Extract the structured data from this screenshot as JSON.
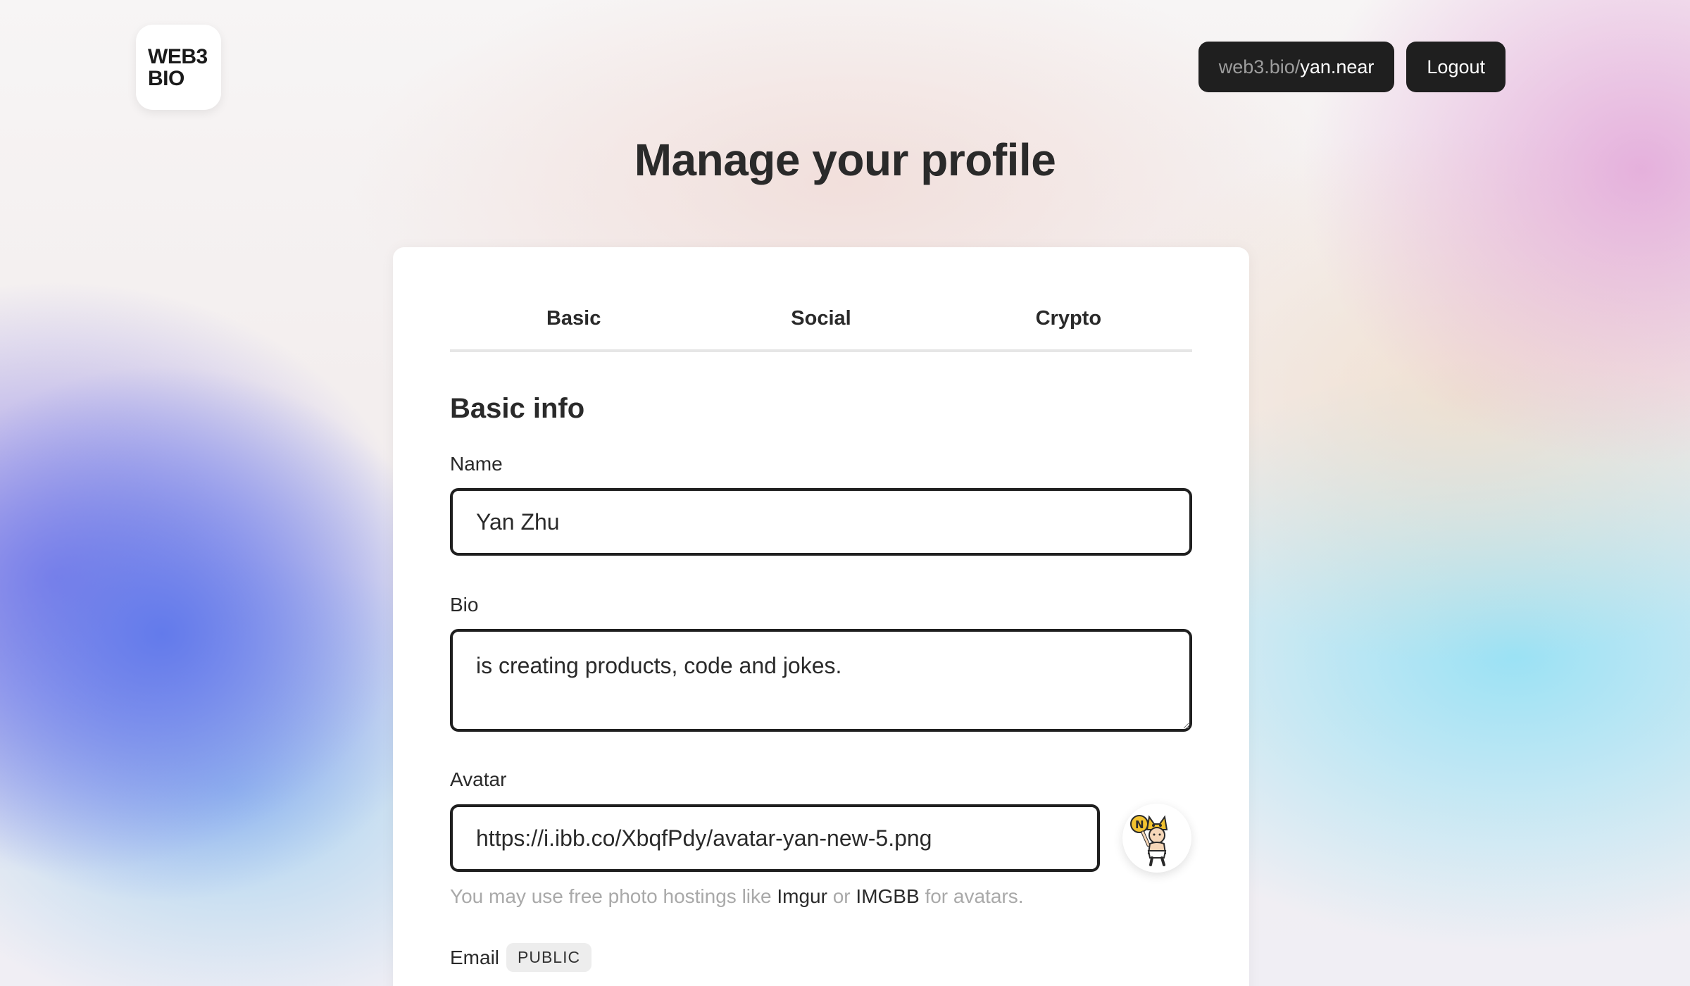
{
  "logo": {
    "line1": "WEB3",
    "line2": "BIO"
  },
  "header": {
    "profile_url_prefix": "web3.bio/",
    "profile_handle": "yan.near",
    "logout_label": "Logout"
  },
  "page_title": "Manage your profile",
  "tabs": [
    {
      "label": "Basic"
    },
    {
      "label": "Social"
    },
    {
      "label": "Crypto"
    }
  ],
  "form": {
    "section_title": "Basic info",
    "name": {
      "label": "Name",
      "value": "Yan Zhu"
    },
    "bio": {
      "label": "Bio",
      "value": "is creating products, code and jokes."
    },
    "avatar": {
      "label": "Avatar",
      "value": "https://i.ibb.co/XbqfPdy/avatar-yan-new-5.png",
      "hint_prefix": "You may use free photo hostings like",
      "hint_link1": "Imgur",
      "hint_or": "or",
      "hint_link2": "IMGBB",
      "hint_suffix": "for avatars."
    },
    "email": {
      "label": "Email",
      "badge": "PUBLIC"
    }
  }
}
